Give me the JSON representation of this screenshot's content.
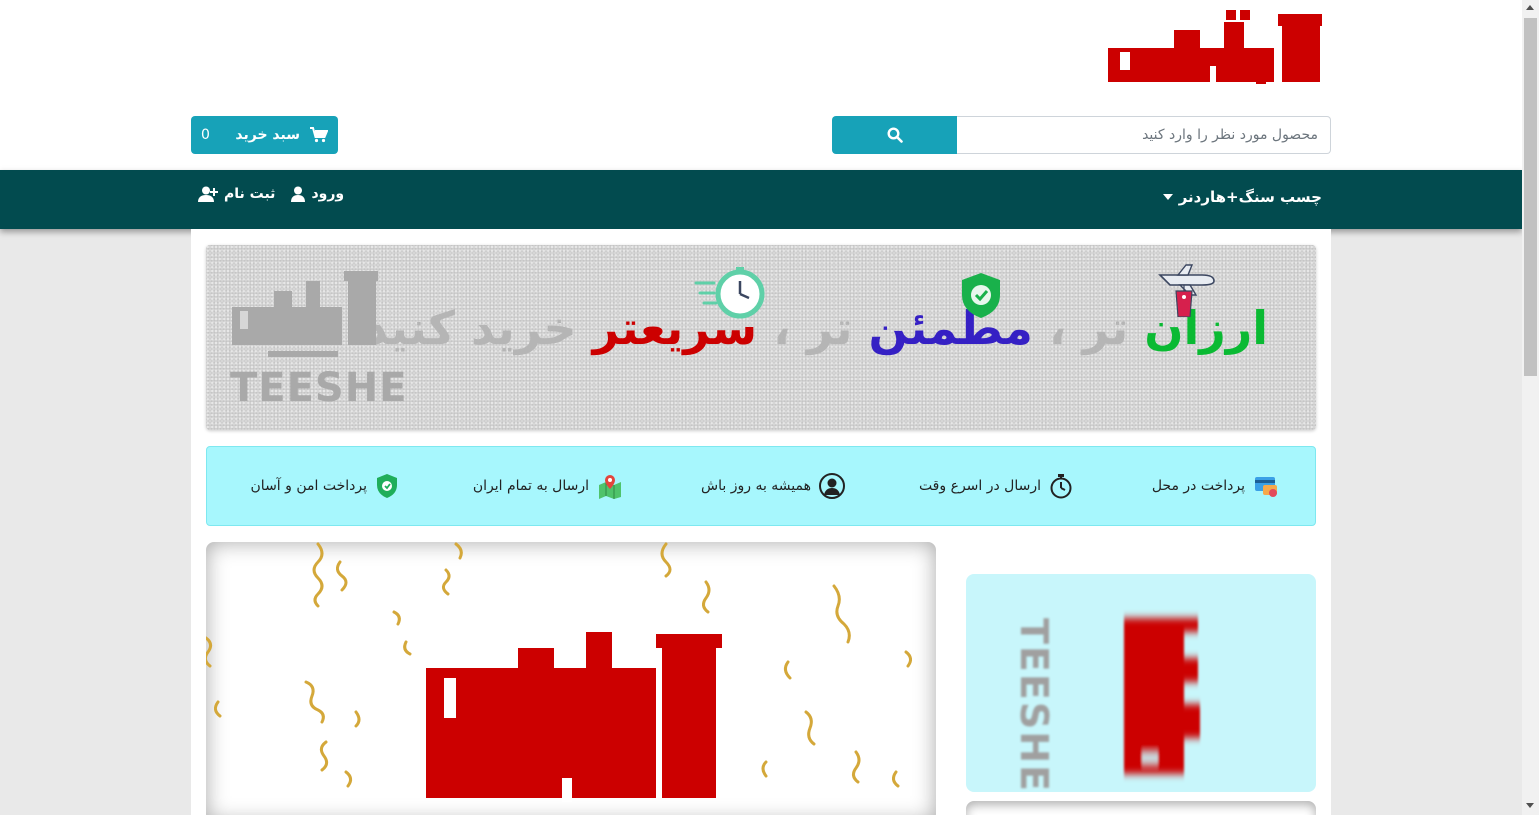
{
  "header": {
    "brand_logo": "teeshe-logo",
    "search": {
      "placeholder": "محصول مورد نظر را وارد کنید",
      "value": "",
      "button_icon": "search-icon"
    },
    "cart": {
      "label": "سبد خرید",
      "count": "0",
      "icon": "cart-icon"
    }
  },
  "nav": {
    "category_label": "چسب سنگ+هاردنر",
    "login_label": "ورود",
    "register_label": "ثبت نام"
  },
  "banner": {
    "word1": "ارزان",
    "sep1": " تر ، ",
    "word2": "مطمئن",
    "sep2": " تر ، ",
    "word3": "سریعتر",
    "tail": " خرید کنید",
    "logo_caption": "TEESHE"
  },
  "features": [
    {
      "label": "پرداخت در محل",
      "icon": "card-payment-icon"
    },
    {
      "label": "ارسال در اسرع وقت",
      "icon": "stopwatch-icon"
    },
    {
      "label": "همیشه به روز باش",
      "icon": "support-user-icon"
    },
    {
      "label": "ارسال به تمام ایران",
      "icon": "map-pin-icon"
    },
    {
      "label": "پرداخت امن و آسان",
      "icon": "shield-icon"
    }
  ],
  "promo": {
    "side_caption": "TEESHE"
  },
  "colors": {
    "accent": "#17a2b8",
    "nav": "#024b4f",
    "brand_red": "#cc0000",
    "features_bg": "#a7f7fd"
  }
}
